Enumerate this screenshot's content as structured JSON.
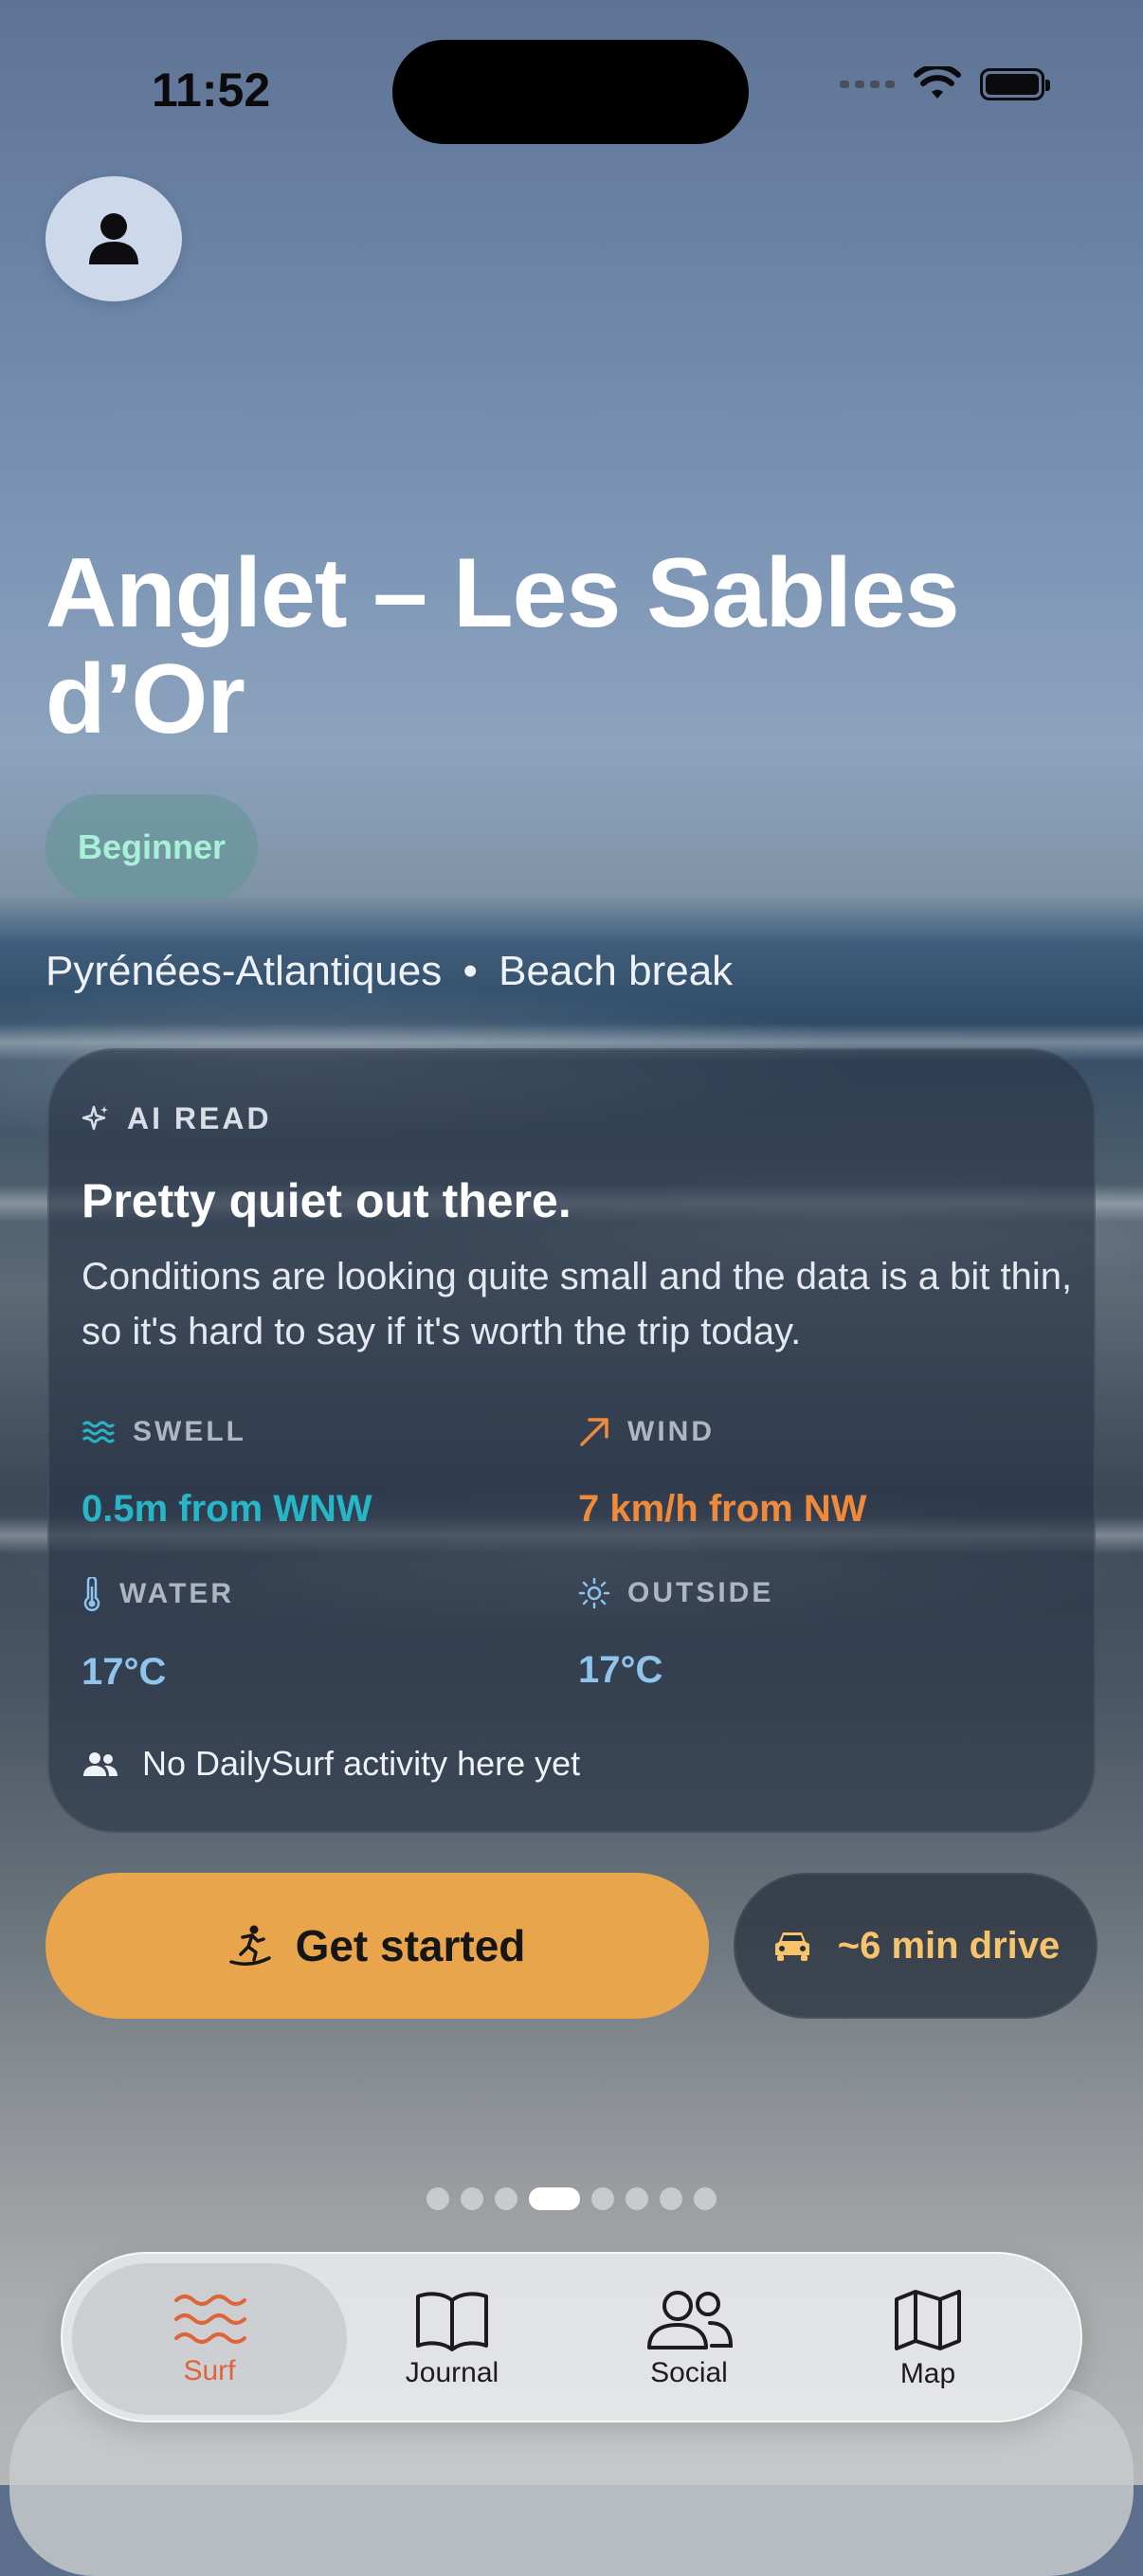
{
  "status_bar": {
    "time": "11:52"
  },
  "spot": {
    "name": "Anglet – Les Sables d’Or",
    "level": "Beginner",
    "region": "Pyrénées-Atlantiques",
    "break_type": "Beach break",
    "separator": "•"
  },
  "ai_read": {
    "label": "AI READ",
    "headline": "Pretty quiet out there.",
    "body": "Conditions are looking quite small and the data is a bit thin, so it's hard to say if it's worth the trip today.",
    "metrics": {
      "swell": {
        "label": "SWELL",
        "value": "0.5m from WNW",
        "color": "#27b6c8"
      },
      "wind": {
        "label": "WIND",
        "value": "7 km/h from NW",
        "color": "#ef8a3c"
      },
      "water": {
        "label": "WATER",
        "value": "17°C",
        "color": "#8fc4ec"
      },
      "outside": {
        "label": "OUTSIDE",
        "value": "17°C",
        "color": "#8fc4ec"
      }
    },
    "activity": "No DailySurf activity here yet"
  },
  "actions": {
    "primary": "Get started",
    "drive": "~6 min drive"
  },
  "pager": {
    "count": 8,
    "active_index": 3
  },
  "tabs": [
    {
      "label": "Surf",
      "icon": "waves-icon",
      "active": true
    },
    {
      "label": "Journal",
      "icon": "book-icon",
      "active": false
    },
    {
      "label": "Social",
      "icon": "people-icon",
      "active": false
    },
    {
      "label": "Map",
      "icon": "map-icon",
      "active": false
    }
  ],
  "colors": {
    "accent": "#e8a54b",
    "tab_active": "#e0643a",
    "drive_text": "#f7c46e"
  }
}
